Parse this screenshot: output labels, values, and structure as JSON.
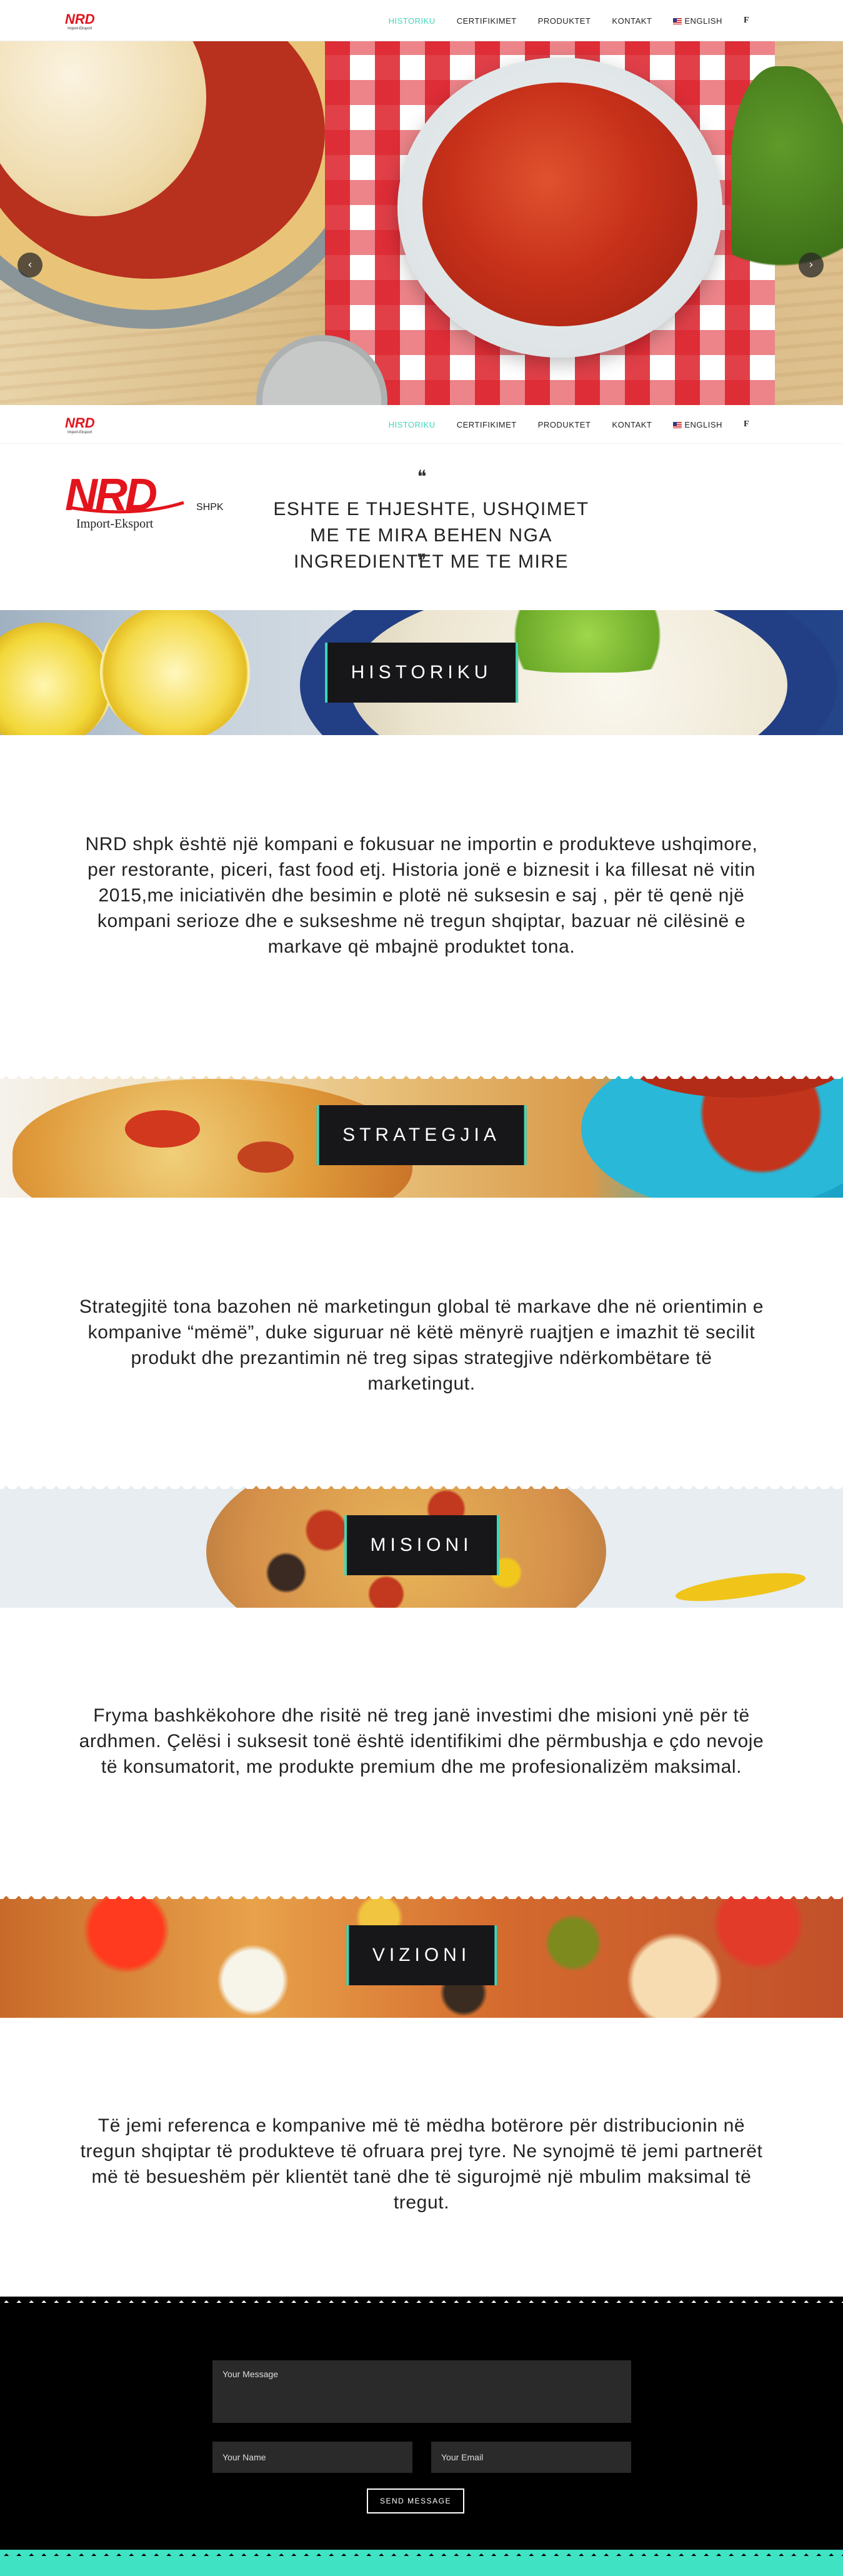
{
  "brand": {
    "logo_text": "NRD",
    "logo_suffix": "SHPK",
    "logo_tagline": "Import-Eksport",
    "accent_color": "#3fd8b8",
    "logo_color": "#e3141c"
  },
  "nav": {
    "items": [
      {
        "label": "HISTORIKU",
        "active": true
      },
      {
        "label": "CERTIFIKIMET",
        "active": false
      },
      {
        "label": "PRODUKTET",
        "active": false
      },
      {
        "label": "KONTAKT",
        "active": false
      },
      {
        "label": "ENGLISH",
        "active": false
      }
    ],
    "facebook_icon": "f"
  },
  "slider": {
    "prev_icon": "‹",
    "next_icon": "›",
    "slide_count": 3,
    "active_slide": 2
  },
  "quote": {
    "open_mark": "❝",
    "close_mark": "❞",
    "text": "ESHTE E THJESHTE, USHQIMET ME TE MIRA BEHEN NGA INGREDIENTET ME TE MIRE"
  },
  "sections": [
    {
      "title": "HISTORIKU",
      "body": "NRD shpk është një kompani e fokusuar ne importin e produkteve ushqimore, per restorante, piceri, fast food etj. Historia jonë e biznesit i ka fillesat në vitin 2015,me iniciativën dhe besimin e plotë në suksesin e saj , për të qenë një kompani serioze dhe e sukseshme në tregun shqiptar, bazuar në cilësinë e markave që mbajnë produktet tona."
    },
    {
      "title": "STRATEGJIA",
      "body": "Strategjitë tona bazohen në marketingun global të markave dhe në orientimin e kompanive “mëmë”, duke siguruar në këtë mënyrë ruajtjen e imazhit të secilit produkt dhe prezantimin në treg sipas strategjive ndërkombëtare të marketingut."
    },
    {
      "title": "MISIONI",
      "body": "Fryma bashkëkohore dhe risitë në treg janë investimi dhe misioni ynë për të ardhmen. Çelësi i suksesit tonë është identifikimi dhe përmbushja e çdo nevoje të konsumatorit, me produkte premium dhe me profesionalizëm maksimal."
    },
    {
      "title": "VIZIONI",
      "body": "Të jemi referenca e kompanive më të mëdha botërore për distribucionin në tregun shqiptar të produkteve të ofruara prej tyre. Ne synojmë të jemi partnerët më të besueshëm për klientët tanë dhe të sigurojmë një mbulim maksimal të tregut."
    }
  ],
  "contact": {
    "message_placeholder": "Your Message",
    "name_placeholder": "Your Name",
    "email_placeholder": "Your Email",
    "send_label": "SEND MESSAGE"
  }
}
